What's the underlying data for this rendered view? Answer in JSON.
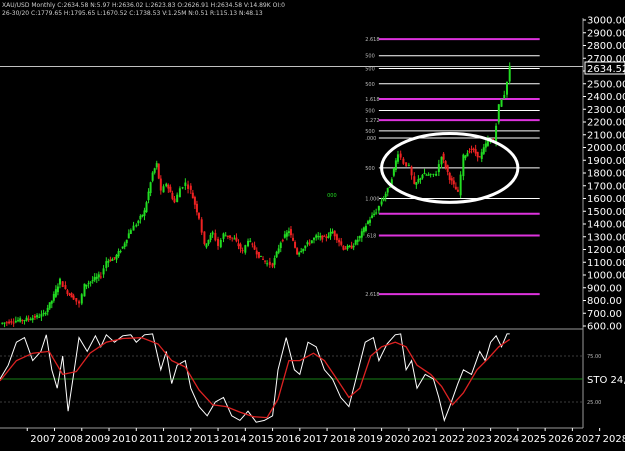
{
  "header": {
    "line1": "XAU/USD  Monthly  C:2634.58  N:5.97  H:2636.02  L:2623.83  O:2626.91  H:2634.58  V:14.89K  OI:0",
    "line2": "26-30/20  C:1779.65  H:1795.65  L:1670.52  C:1738.53  V:1.25M  N:0.51  R:115.13  N:48.13"
  },
  "last_price_label": "2634.52",
  "colors": {
    "background": "#000000",
    "up": "#22dd22",
    "down": "#ee2222",
    "fib": "#dd33dd",
    "stoch_k": "#ffffff",
    "stoch_d": "#dd2222",
    "separator": "#9a9a9a"
  },
  "chart_data": [
    {
      "type": "candlestick",
      "title": "",
      "x": [
        "2007",
        "2008",
        "2009",
        "2010",
        "2011",
        "2012",
        "2013",
        "2014",
        "2015",
        "2016",
        "2017",
        "2018",
        "2019",
        "2020",
        "2021",
        "2022",
        "2023",
        "2024",
        "2025",
        "2026",
        "2027",
        "2028"
      ],
      "ylim": [
        600,
        3000
      ],
      "y_ticks": [
        "3000.00",
        "2900.00",
        "2800.00",
        "2700.00",
        "2600.00",
        "2500.00",
        "2400.00",
        "2300.00",
        "2200.00",
        "2100.00",
        "2000.00",
        "1900.00",
        "1800.00",
        "1700.00",
        "1600.00",
        "1500.00",
        "1400.00",
        "1300.00",
        "1200.00",
        "1100.00",
        "1000.00",
        "900.00",
        "800.00",
        "700.00",
        "600.00"
      ],
      "series": [
        {
          "values": [
            [
              2006.0,
              620
            ],
            [
              2006.5,
              640
            ],
            [
              2006.9,
              650
            ],
            [
              2007.2,
              665
            ],
            [
              2007.6,
              690
            ],
            [
              2007.9,
              800
            ],
            [
              2008.2,
              960
            ],
            [
              2008.4,
              880
            ],
            [
              2008.7,
              820
            ],
            [
              2008.9,
              770
            ],
            [
              2009.1,
              920
            ],
            [
              2009.4,
              960
            ],
            [
              2009.7,
              1000
            ],
            [
              2009.9,
              1110
            ],
            [
              2010.2,
              1130
            ],
            [
              2010.5,
              1220
            ],
            [
              2010.8,
              1360
            ],
            [
              2011.0,
              1400
            ],
            [
              2011.3,
              1500
            ],
            [
              2011.6,
              1800
            ],
            [
              2011.75,
              1870
            ],
            [
              2011.9,
              1650
            ],
            [
              2012.1,
              1720
            ],
            [
              2012.4,
              1570
            ],
            [
              2012.6,
              1680
            ],
            [
              2012.8,
              1720
            ],
            [
              2013.0,
              1660
            ],
            [
              2013.3,
              1450
            ],
            [
              2013.5,
              1230
            ],
            [
              2013.8,
              1330
            ],
            [
              2014.0,
              1230
            ],
            [
              2014.2,
              1320
            ],
            [
              2014.6,
              1280
            ],
            [
              2014.9,
              1180
            ],
            [
              2015.1,
              1280
            ],
            [
              2015.5,
              1150
            ],
            [
              2015.8,
              1090
            ],
            [
              2016.0,
              1080
            ],
            [
              2016.3,
              1260
            ],
            [
              2016.6,
              1350
            ],
            [
              2016.9,
              1170
            ],
            [
              2017.2,
              1230
            ],
            [
              2017.6,
              1300
            ],
            [
              2017.9,
              1290
            ],
            [
              2018.2,
              1340
            ],
            [
              2018.6,
              1210
            ],
            [
              2018.9,
              1220
            ],
            [
              2019.2,
              1300
            ],
            [
              2019.5,
              1420
            ],
            [
              2019.8,
              1500
            ],
            [
              2020.0,
              1580
            ],
            [
              2020.3,
              1700
            ],
            [
              2020.6,
              1960
            ],
            [
              2020.8,
              1880
            ],
            [
              2021.0,
              1850
            ],
            [
              2021.2,
              1700
            ],
            [
              2021.5,
              1790
            ],
            [
              2021.8,
              1780
            ],
            [
              2022.0,
              1800
            ],
            [
              2022.2,
              1940
            ],
            [
              2022.5,
              1760
            ],
            [
              2022.8,
              1640
            ],
            [
              2023.0,
              1930
            ],
            [
              2023.3,
              1990
            ],
            [
              2023.6,
              1920
            ],
            [
              2023.9,
              2060
            ],
            [
              2024.1,
              2040
            ],
            [
              2024.3,
              2330
            ],
            [
              2024.5,
              2420
            ],
            [
              2024.7,
              2630
            ]
          ]
        }
      ],
      "fib_levels": [
        {
          "price": 2850,
          "label": "2.618",
          "color": "fib"
        },
        {
          "price": 2720,
          "label": "500",
          "color": "white"
        },
        {
          "price": 2620,
          "label": "500",
          "color": "white"
        },
        {
          "price": 2500,
          "label": "500",
          "color": "white"
        },
        {
          "price": 2380,
          "label": "1.618",
          "color": "fib"
        },
        {
          "price": 2290,
          "label": "500",
          "color": "white"
        },
        {
          "price": 2215,
          "label": "1.272",
          "color": "fib"
        },
        {
          "price": 2130,
          "label": "500",
          "color": "white"
        },
        {
          "price": 2075,
          "label": ".000",
          "color": "white"
        },
        {
          "price": 1840,
          "label": "500",
          "color": "white"
        },
        {
          "price": 1600,
          "label": "1.000",
          "color": "white"
        },
        {
          "price": 1480,
          "label": "",
          "color": "fib"
        },
        {
          "price": 1310,
          "label": ".618",
          "color": "fib"
        },
        {
          "price": 850,
          "label": "2.618",
          "color": "fib"
        }
      ],
      "annotations": [
        {
          "type": "ellipse",
          "center": [
            2022.5,
            1840
          ],
          "radius_years": 2.5,
          "radius_price": 270,
          "color": "#ffffff"
        },
        {
          "type": "text",
          "text": "000",
          "at": [
            2018.0,
            1610
          ]
        }
      ]
    },
    {
      "type": "line",
      "title": "",
      "label": "STO 24,",
      "ylim": [
        0,
        100
      ],
      "y_ticks": [
        "75.00",
        "25.00"
      ],
      "series": [
        {
          "name": "STO %K",
          "values": [
            [
              2006.0,
              50
            ],
            [
              2006.3,
              65
            ],
            [
              2006.6,
              90
            ],
            [
              2006.9,
              95
            ],
            [
              2007.2,
              70
            ],
            [
              2007.5,
              80
            ],
            [
              2007.7,
              98
            ],
            [
              2007.9,
              60
            ],
            [
              2008.1,
              40
            ],
            [
              2008.3,
              75
            ],
            [
              2008.5,
              15
            ],
            [
              2008.7,
              55
            ],
            [
              2008.9,
              95
            ],
            [
              2009.2,
              80
            ],
            [
              2009.5,
              97
            ],
            [
              2009.7,
              85
            ],
            [
              2009.9,
              98
            ],
            [
              2010.2,
              90
            ],
            [
              2010.5,
              97
            ],
            [
              2010.8,
              98
            ],
            [
              2011.0,
              90
            ],
            [
              2011.3,
              98
            ],
            [
              2011.6,
              99
            ],
            [
              2011.9,
              60
            ],
            [
              2012.1,
              80
            ],
            [
              2012.3,
              45
            ],
            [
              2012.5,
              65
            ],
            [
              2012.8,
              70
            ],
            [
              2013.0,
              40
            ],
            [
              2013.3,
              20
            ],
            [
              2013.6,
              10
            ],
            [
              2013.9,
              25
            ],
            [
              2014.2,
              30
            ],
            [
              2014.5,
              10
            ],
            [
              2014.8,
              5
            ],
            [
              2015.1,
              15
            ],
            [
              2015.4,
              3
            ],
            [
              2015.7,
              5
            ],
            [
              2016.0,
              10
            ],
            [
              2016.2,
              60
            ],
            [
              2016.5,
              95
            ],
            [
              2016.8,
              60
            ],
            [
              2017.0,
              55
            ],
            [
              2017.3,
              90
            ],
            [
              2017.6,
              85
            ],
            [
              2017.9,
              60
            ],
            [
              2018.2,
              50
            ],
            [
              2018.5,
              30
            ],
            [
              2018.8,
              20
            ],
            [
              2019.1,
              55
            ],
            [
              2019.4,
              90
            ],
            [
              2019.7,
              95
            ],
            [
              2019.9,
              70
            ],
            [
              2020.2,
              88
            ],
            [
              2020.5,
              98
            ],
            [
              2020.7,
              99
            ],
            [
              2020.9,
              60
            ],
            [
              2021.1,
              70
            ],
            [
              2021.3,
              40
            ],
            [
              2021.6,
              55
            ],
            [
              2021.9,
              50
            ],
            [
              2022.1,
              30
            ],
            [
              2022.3,
              5
            ],
            [
              2022.5,
              20
            ],
            [
              2022.8,
              45
            ],
            [
              2023.0,
              60
            ],
            [
              2023.3,
              55
            ],
            [
              2023.6,
              80
            ],
            [
              2023.8,
              70
            ],
            [
              2024.0,
              90
            ],
            [
              2024.2,
              97
            ],
            [
              2024.4,
              85
            ],
            [
              2024.6,
              99
            ],
            [
              2024.7,
              99
            ]
          ]
        },
        {
          "name": "STO %D",
          "values": [
            [
              2006.0,
              48
            ],
            [
              2006.6,
              70
            ],
            [
              2007.2,
              78
            ],
            [
              2007.8,
              80
            ],
            [
              2008.3,
              55
            ],
            [
              2008.8,
              58
            ],
            [
              2009.3,
              78
            ],
            [
              2009.9,
              90
            ],
            [
              2010.5,
              94
            ],
            [
              2011.2,
              95
            ],
            [
              2011.8,
              88
            ],
            [
              2012.3,
              70
            ],
            [
              2012.8,
              63
            ],
            [
              2013.3,
              38
            ],
            [
              2013.8,
              22
            ],
            [
              2014.3,
              20
            ],
            [
              2014.8,
              14
            ],
            [
              2015.3,
              9
            ],
            [
              2015.8,
              8
            ],
            [
              2016.2,
              28
            ],
            [
              2016.6,
              70
            ],
            [
              2017.0,
              70
            ],
            [
              2017.5,
              78
            ],
            [
              2017.9,
              70
            ],
            [
              2018.4,
              48
            ],
            [
              2018.8,
              30
            ],
            [
              2019.2,
              40
            ],
            [
              2019.6,
              75
            ],
            [
              2020.0,
              85
            ],
            [
              2020.5,
              90
            ],
            [
              2020.9,
              85
            ],
            [
              2021.3,
              65
            ],
            [
              2021.8,
              55
            ],
            [
              2022.2,
              42
            ],
            [
              2022.6,
              22
            ],
            [
              2023.0,
              35
            ],
            [
              2023.5,
              60
            ],
            [
              2023.9,
              72
            ],
            [
              2024.3,
              85
            ],
            [
              2024.7,
              93
            ]
          ]
        }
      ]
    }
  ]
}
